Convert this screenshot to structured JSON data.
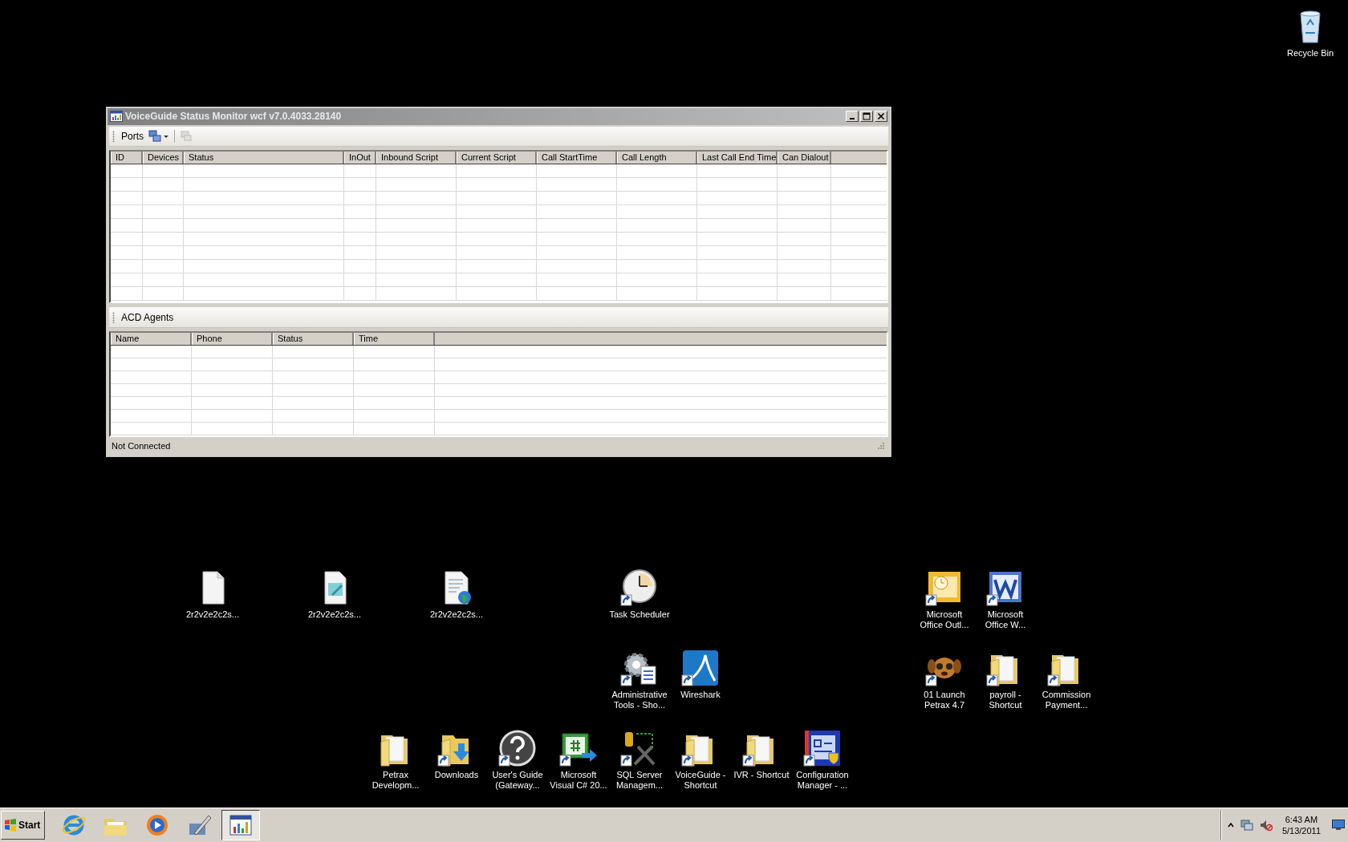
{
  "desktop_icons": [
    {
      "label": "Recycle Bin",
      "kind": "recycle",
      "shortcut": false
    },
    {
      "label": "2r2v2e2c2s...",
      "kind": "file",
      "shortcut": false
    },
    {
      "label": "2r2v2e2c2s...",
      "kind": "notepad",
      "shortcut": false
    },
    {
      "label": "2r2v2e2c2s...",
      "kind": "webdoc",
      "shortcut": false
    },
    {
      "label": "Task Scheduler",
      "kind": "clock",
      "shortcut": true
    },
    {
      "label": "Microsoft Office Outl...",
      "kind": "outlook",
      "shortcut": true
    },
    {
      "label": "Microsoft Office W...",
      "kind": "word",
      "shortcut": true
    },
    {
      "label": "Administrative Tools - Sho...",
      "kind": "tools",
      "shortcut": true
    },
    {
      "label": "Wireshark",
      "kind": "fin",
      "shortcut": true
    },
    {
      "label": "01 Launch Petrax 4.7",
      "kind": "dog",
      "shortcut": true
    },
    {
      "label": "payroll - Shortcut",
      "kind": "folder",
      "shortcut": true
    },
    {
      "label": "Commission Payment...",
      "kind": "folder",
      "shortcut": true
    },
    {
      "label": "Petrax Developm...",
      "kind": "folder",
      "shortcut": false
    },
    {
      "label": "Downloads",
      "kind": "downloads",
      "shortcut": true
    },
    {
      "label": "User's Guide (Gateway...",
      "kind": "help",
      "shortcut": true
    },
    {
      "label": "Microsoft Visual C# 20...",
      "kind": "csharp",
      "shortcut": true
    },
    {
      "label": "SQL Server Managem...",
      "kind": "sql",
      "shortcut": true
    },
    {
      "label": "VoiceGuide - Shortcut",
      "kind": "folder",
      "shortcut": true
    },
    {
      "label": "IVR - Shortcut",
      "kind": "folder",
      "shortcut": true
    },
    {
      "label": "Configuration Manager - ...",
      "kind": "config",
      "shortcut": true
    }
  ],
  "window": {
    "title": "VoiceGuide Status Monitor wcf v7.0.4033.28140",
    "toolbar_label": "Ports",
    "ports_table": {
      "columns": [
        "ID",
        "Devices",
        "Status",
        "InOut",
        "Inbound Script",
        "Current Script",
        "Call StartTime",
        "Call Length",
        "Last Call End Time",
        "Can Dialout"
      ]
    },
    "agents_toolbar_label": "ACD Agents",
    "agents_table": {
      "columns": [
        "Name",
        "Phone",
        "Status",
        "Time"
      ]
    },
    "status_bar": "Not Connected"
  },
  "taskbar": {
    "start": "Start",
    "apps": [
      {
        "kind": "ie",
        "selected": false
      },
      {
        "kind": "explorer",
        "selected": false
      },
      {
        "kind": "media",
        "selected": false
      },
      {
        "kind": "tool",
        "selected": false
      },
      {
        "kind": "monitor",
        "selected": true
      }
    ],
    "time": "6:43 AM",
    "date": "5/13/2011"
  }
}
